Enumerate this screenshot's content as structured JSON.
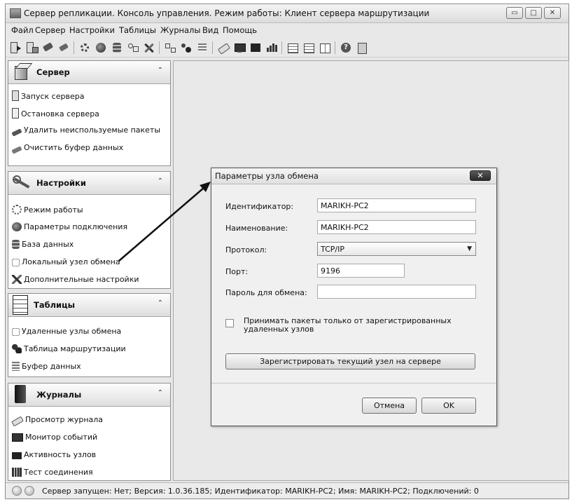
{
  "window": {
    "title": "Сервер репликации. Консоль управления. Режим работы: Клиент сервера маршрутизации",
    "controls": [
      "minimize-icon",
      "maximize-icon",
      "close-icon"
    ]
  },
  "menu": [
    "Файл",
    "Сервер",
    "Настройки",
    "Таблицы",
    "Журналы",
    "Вид",
    "Помощь"
  ],
  "toolbar_icons": [
    "start-server-icon",
    "stop-server-icon",
    "delete-packets-icon",
    "clear-buffer-icon",
    "mode-gear-icon",
    "connection-globe-icon",
    "database-icon",
    "local-node-icon",
    "settings-tools-icon",
    "remote-nodes-icon",
    "routing-table-icon",
    "data-buffer-icon",
    "view-log-icon",
    "event-monitor-icon",
    "node-activity-icon",
    "connection-test-icon",
    "tile-icon",
    "list-icon",
    "columns-icon",
    "help-icon",
    "about-icon"
  ],
  "panels": {
    "server": {
      "title": "Сервер",
      "items": [
        {
          "label": "Запуск сервера",
          "icon": "start-server-icon"
        },
        {
          "label": "Остановка сервера",
          "icon": "stop-server-icon"
        },
        {
          "label": "Удалить неиспользуемые пакеты",
          "icon": "broom-icon"
        },
        {
          "label": "Очистить буфер данных",
          "icon": "broom-icon"
        }
      ]
    },
    "settings": {
      "title": "Настройки",
      "items": [
        {
          "label": "Режим работы",
          "icon": "gear-icon"
        },
        {
          "label": "Параметры подключения",
          "icon": "globe-icon"
        },
        {
          "label": "База данных",
          "icon": "database-icon"
        },
        {
          "label": "Локальный узел обмена",
          "icon": "node-icon"
        },
        {
          "label": "Дополнительные настройки",
          "icon": "tools-icon"
        }
      ]
    },
    "tables": {
      "title": "Таблицы",
      "items": [
        {
          "label": "Удаленные узлы обмена",
          "icon": "node-icon"
        },
        {
          "label": "Таблица маршрутизации",
          "icon": "users-icon"
        },
        {
          "label": "Буфер данных",
          "icon": "stack-icon"
        }
      ]
    },
    "journals": {
      "title": "Журналы",
      "items": [
        {
          "label": "Просмотр журнала",
          "icon": "eraser-icon"
        },
        {
          "label": "Монитор событий",
          "icon": "monitor-icon"
        },
        {
          "label": "Активность узлов",
          "icon": "activity-icon"
        },
        {
          "label": "Тест соединения",
          "icon": "bar-chart-icon"
        }
      ]
    }
  },
  "dialog": {
    "title": "Параметры узла обмена",
    "identifier_label": "Идентификатор:",
    "identifier_value": "MARIKH-PC2",
    "name_label": "Наименование:",
    "name_value": "MARIKH-PC2",
    "protocol_label": "Протокол:",
    "protocol_value": "TCP/IP",
    "port_label": "Порт:",
    "port_value": "9196",
    "password_label": "Пароль для обмена:",
    "password_value": "",
    "checkbox_line1": "Принимать пакеты только от зарегистрированных",
    "checkbox_line2": "удаленных узлов",
    "checkbox_checked": false,
    "register_button": "Зарегистрировать текущий узел на сервере",
    "cancel_button": "Отмена",
    "ok_button": "OK"
  },
  "status": {
    "text": "Сервер запущен: Нет; Версия: 1.0.36.185; Идентификатор: MARIKH-PC2; Имя: MARIKH-PC2; Подключений: 0"
  },
  "colors": {
    "window_bg": "#e8e8e8",
    "panel_bg": "#ffffff",
    "dialog_bg": "#f0f0f0",
    "arrow": "#111111"
  }
}
